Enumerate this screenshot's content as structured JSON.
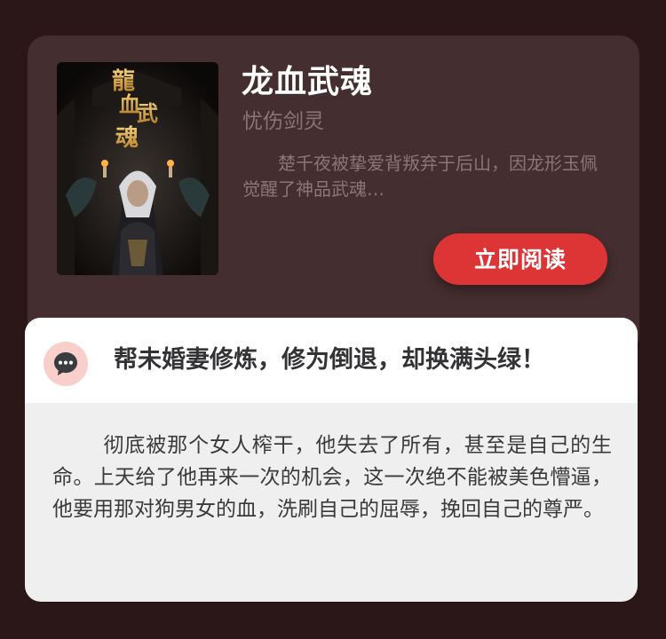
{
  "book": {
    "title": "龙血武魂",
    "author": "忧伤剑灵",
    "description": "楚千夜被挚爱背叛弃于后山，因龙形玉佩觉醒了神品武魂…",
    "read_button_label": "立即阅读",
    "cover_title_art": "龍血武魂"
  },
  "review": {
    "icon": "comment-bubble-icon",
    "title": "帮未婚妻修炼，修为倒退，却换满头绿！",
    "body": "彻底被那个女人榨干，他失去了所有，甚至是自己的生命。上天给了他再来一次的机会，这一次绝不能被美色懵逼，他要用那对狗男女的血，洗刷自己的屈辱，挽回自己的尊严。"
  },
  "colors": {
    "page_background": "#2b1618",
    "book_card_background": "#452e2f",
    "accent_button": "#dd3535",
    "muted_text": "#8a7676",
    "icon_badge": "#f9cfcb",
    "icon_fill": "#3a3c40"
  }
}
